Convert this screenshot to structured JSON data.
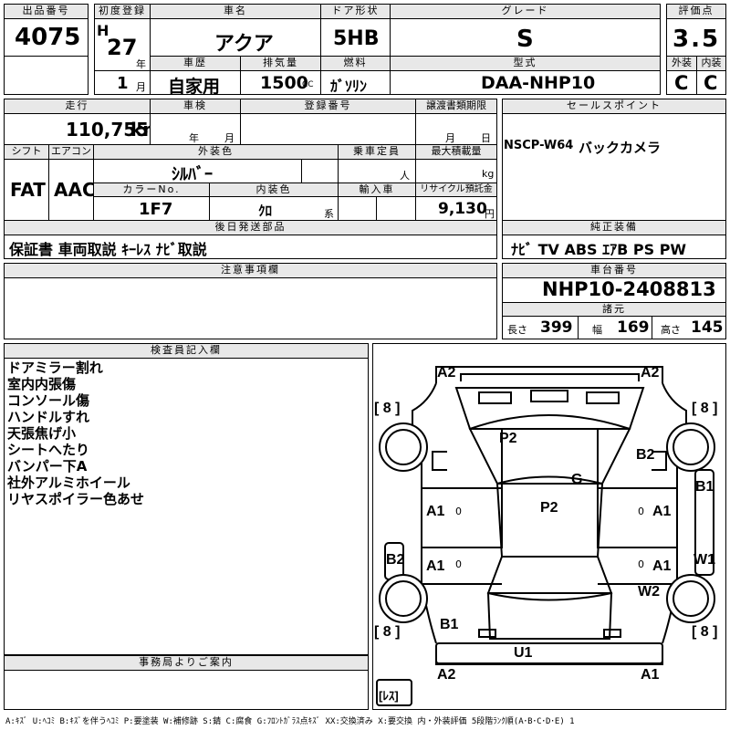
{
  "header": {
    "lot_label": "出品番号",
    "lot_number": "4075",
    "first_reg_label": "初度登録",
    "era": "H",
    "year": "27",
    "year_unit": "年",
    "month": "1",
    "month_unit": "月",
    "car_name_label": "車名",
    "car_name": "アクア",
    "door_label": "ドア形状",
    "door": "5HB",
    "grade_label": "グレード",
    "grade": "S",
    "score_label": "評価点",
    "score": "3.5",
    "history_label": "車歴",
    "history": "自家用",
    "displacement_label": "排気量",
    "displacement": "1500",
    "displacement_unit": "CC",
    "fuel_label": "燃料",
    "fuel": "ｶﾞｿﾘﾝ",
    "model_label": "型式",
    "model": "DAA-NHP10",
    "exterior_label": "外装",
    "exterior": "C",
    "interior_label": "内装",
    "interior": "C"
  },
  "row2": {
    "mileage_label": "走行",
    "mileage": "110,755",
    "mileage_unit": "km",
    "inspection_label": "車検",
    "insp_year": "年",
    "insp_month": "月",
    "reg_no_label": "登録番号",
    "transfer_label": "譲渡書類期限",
    "transfer_month": "月",
    "transfer_day": "日",
    "sales_label": "セールスポイント",
    "sales_nav": "NSCP-W64",
    "sales_text": "バックカメラ"
  },
  "row3": {
    "shift_label": "シフト",
    "shift": "FAT",
    "ac_label": "エアコン",
    "ac": "AAC",
    "ext_color_label": "外装色",
    "ext_color": "ｼﾙﾊﾞｰ",
    "capacity_label": "乗車定員",
    "capacity_unit": "人",
    "load_label": "最大積載量",
    "load_unit": "kg",
    "color_no_label": "カラーNo.",
    "color_no": "1F7",
    "int_color_label": "内装色",
    "int_color": "ｸﾛ",
    "int_color_unit": "系",
    "import_label": "輸入車",
    "recycle_label": "リサイクル預託金",
    "recycle": "9,130",
    "recycle_unit": "円"
  },
  "later_parts": {
    "label": "後日発送部品",
    "text": "保証書 車両取説 ｷｰﾚｽ ﾅﾋﾞ取説"
  },
  "genuine": {
    "label": "純正装備",
    "text": "ﾅﾋﾞ TV ABS ｴｱB PS PW"
  },
  "caution": {
    "label": "注意事項欄"
  },
  "chassis": {
    "label": "車台番号",
    "number": "NHP10-2408813",
    "specs_label": "諸元",
    "length_label": "長さ",
    "length": "399",
    "width_label": "幅",
    "width": "169",
    "height_label": "高さ",
    "height": "145"
  },
  "inspector": {
    "label": "検査員記入欄",
    "notes": [
      "ドアミラー割れ",
      "室内内張傷",
      "コンソール傷",
      "ハンドルすれ",
      "天張焦げ小",
      "シートへたり",
      "バンパー下A",
      "社外アルミホイール",
      "リヤスポイラー色あせ"
    ]
  },
  "office": {
    "label": "事務局よりご案内"
  },
  "diagram_marks": {
    "front_left": "A2",
    "front_right": "A2",
    "tire_fl": "[ 8 ]",
    "tire_fr": "[ 8 ]",
    "tire_rl": "[ 8 ]",
    "tire_rr": "[ 8 ]",
    "hood": "P2",
    "right_fender": "B2",
    "windshield": "G",
    "roof": "P2",
    "left_door_front": "A1",
    "left_door_rear": "A1",
    "right_door_front": "A1",
    "right_door_rear": "A1",
    "right_pillar": "B1",
    "left_quarter": "B2",
    "right_quarter": "W1",
    "right_rear_fender": "W2",
    "rear_left": "B1",
    "tailgate": "U1",
    "rear_bumper_left": "A2",
    "rear_bumper_right": "A1",
    "spare": "[ﾚｽ]",
    "door_zero_1": "0",
    "door_zero_2": "0",
    "door_zero_3": "0",
    "door_zero_4": "0"
  },
  "legend": "A:ｷｽﾞ U:ﾍｺﾐ B:ｷｽﾞを伴うﾍｺﾐ P:要塗装 W:補修跡 S:錆 C:腐食 G:ﾌﾛﾝﾄｶﾞﾗｽ点ｷｽﾞ XX:交換済み X:要交換 内・外装評価 5段階ﾗﾝｸ順(A･B･C･D･E) 1",
  "colors": {
    "label_bg": "#e8e8e8",
    "border": "#000000"
  }
}
